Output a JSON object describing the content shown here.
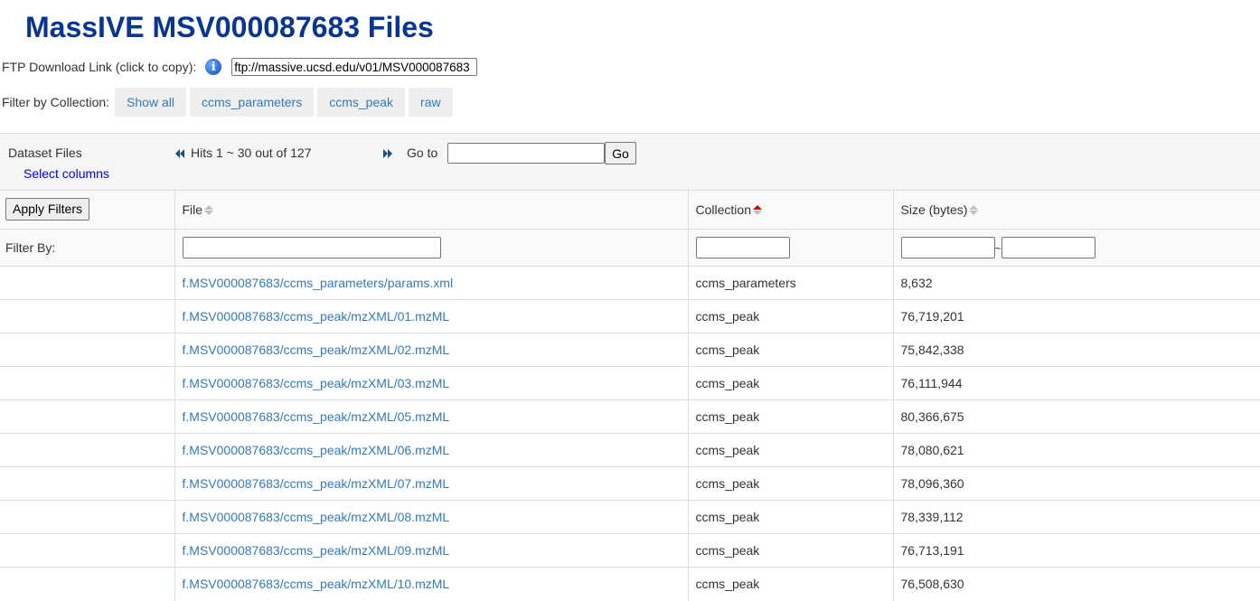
{
  "page_title": "MassIVE MSV000087683 Files",
  "ftp": {
    "label": "FTP Download Link (click to copy):",
    "value": "ftp://massive.ucsd.edu/v01/MSV000087683",
    "icon": "info-icon"
  },
  "collection_filter": {
    "label": "Filter by Collection:",
    "buttons": [
      "Show all",
      "ccms_parameters",
      "ccms_peak",
      "raw"
    ]
  },
  "toolbar": {
    "dataset_files": "Dataset Files",
    "select_columns": "Select columns",
    "hits": "Hits 1 ~ 30 out of 127",
    "goto_label": "Go to",
    "go_button": "Go"
  },
  "table": {
    "apply_filters": "Apply Filters",
    "filter_by": "Filter By:",
    "size_range_separator": "~",
    "columns": [
      {
        "label": "File",
        "sort": "none"
      },
      {
        "label": "Collection",
        "sort": "ascending"
      },
      {
        "label": "Size (bytes)",
        "sort": "none"
      }
    ],
    "rows": [
      {
        "file": "f.MSV000087683/ccms_parameters/params.xml",
        "collection": "ccms_parameters",
        "size": "8,632"
      },
      {
        "file": "f.MSV000087683/ccms_peak/mzXML/01.mzML",
        "collection": "ccms_peak",
        "size": "76,719,201"
      },
      {
        "file": "f.MSV000087683/ccms_peak/mzXML/02.mzML",
        "collection": "ccms_peak",
        "size": "75,842,338"
      },
      {
        "file": "f.MSV000087683/ccms_peak/mzXML/03.mzML",
        "collection": "ccms_peak",
        "size": "76,111,944"
      },
      {
        "file": "f.MSV000087683/ccms_peak/mzXML/05.mzML",
        "collection": "ccms_peak",
        "size": "80,366,675"
      },
      {
        "file": "f.MSV000087683/ccms_peak/mzXML/06.mzML",
        "collection": "ccms_peak",
        "size": "78,080,621"
      },
      {
        "file": "f.MSV000087683/ccms_peak/mzXML/07.mzML",
        "collection": "ccms_peak",
        "size": "78,096,360"
      },
      {
        "file": "f.MSV000087683/ccms_peak/mzXML/08.mzML",
        "collection": "ccms_peak",
        "size": "78,339,112"
      },
      {
        "file": "f.MSV000087683/ccms_peak/mzXML/09.mzML",
        "collection": "ccms_peak",
        "size": "76,713,191"
      },
      {
        "file": "f.MSV000087683/ccms_peak/mzXML/10.mzML",
        "collection": "ccms_peak",
        "size": "76,508,630"
      }
    ]
  },
  "colors": {
    "title": "#083591",
    "link": "#337ab7",
    "sort_active": "#cc0000"
  }
}
